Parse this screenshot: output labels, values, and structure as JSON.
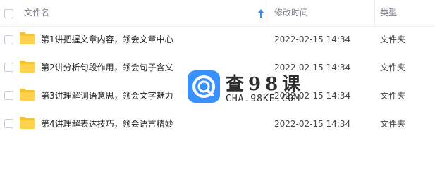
{
  "header": {
    "name_label": "文件名",
    "time_label": "修改时间",
    "type_label": "类型"
  },
  "files": [
    {
      "name": "第1讲把握文章内容，领会文章中心",
      "time": "2022-02-15 14:34",
      "type": "文件夹"
    },
    {
      "name": "第2讲分析句段作用，领会句子含义",
      "time": "2022-02-15 14:34",
      "type": "文件夹"
    },
    {
      "name": "第3讲理解词语意思，领会文字魅力",
      "time": "2022-02-15 14:34",
      "type": "文件夹"
    },
    {
      "name": "第4讲理解表达技巧，领会语言精妙",
      "time": "2022-02-15 14:34",
      "type": "文件夹"
    }
  ],
  "watermark": {
    "name": "查98课",
    "url": "CHA.98KE.COM"
  },
  "colors": {
    "folder": "#FFD24D",
    "folder_tab": "#F5C232",
    "accent": "#2E8CFF"
  }
}
